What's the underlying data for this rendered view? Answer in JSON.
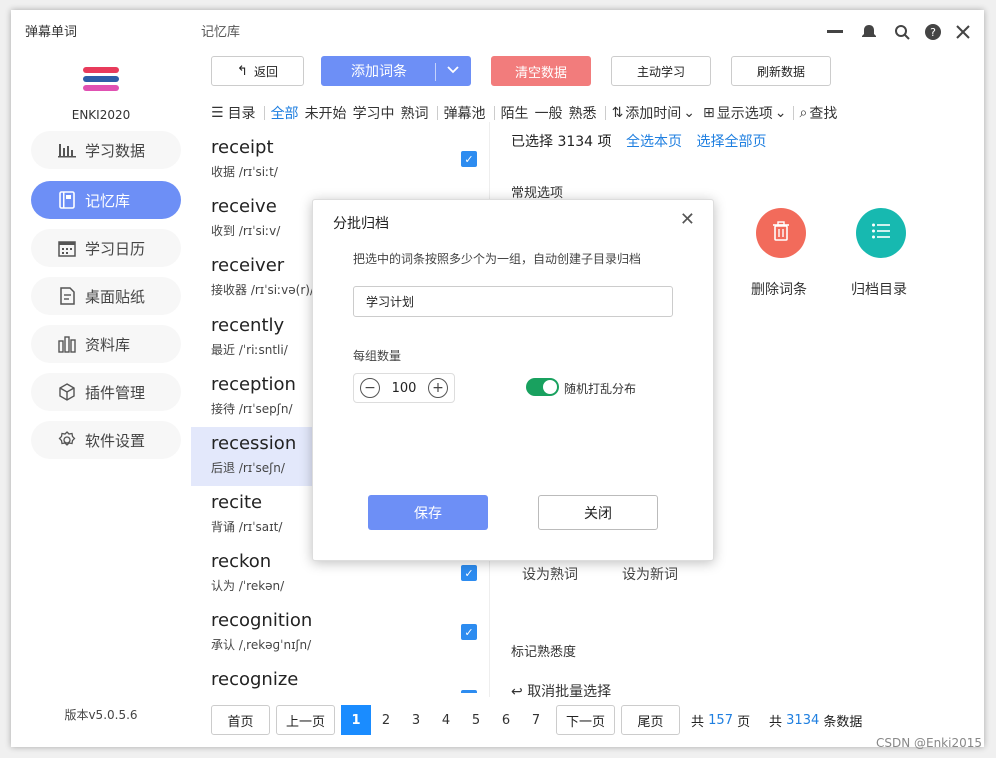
{
  "app": {
    "name": "弹幕单词",
    "window_title": "记忆库",
    "username": "ENKI2020",
    "version": "版本v5.0.5.6"
  },
  "sidebar": {
    "items": [
      {
        "label": "学习数据",
        "icon": "bar-chart-icon"
      },
      {
        "label": "记忆库",
        "icon": "book-icon"
      },
      {
        "label": "学习日历",
        "icon": "calendar-icon"
      },
      {
        "label": "桌面贴纸",
        "icon": "sticker-icon"
      },
      {
        "label": "资料库",
        "icon": "library-icon"
      },
      {
        "label": "插件管理",
        "icon": "cube-icon"
      },
      {
        "label": "软件设置",
        "icon": "gear-icon"
      }
    ]
  },
  "toolbar": {
    "back": "返回",
    "add_words": "添加词条",
    "clear_data": "清空数据",
    "active_learn": "主动学习",
    "refresh": "刷新数据"
  },
  "filters": {
    "catalog": "目录",
    "all": "全部",
    "not_started": "未开始",
    "learning": "学习中",
    "familiar": "熟词",
    "danmaku_pool": "弹幕池",
    "strange": "陌生",
    "normal": "一般",
    "known": "熟悉",
    "add_time": "添加时间",
    "display_options": "显示选项",
    "search": "查找"
  },
  "words": [
    {
      "word": "receipt",
      "meaning": "收据  /rɪˈsiːt/",
      "checked": true
    },
    {
      "word": "receive",
      "meaning": "收到  /rɪˈsiːv/",
      "checked": false
    },
    {
      "word": "receiver",
      "meaning": "接收器  /rɪˈsiːvə(r)/",
      "checked": false
    },
    {
      "word": "recently",
      "meaning": "最近  /ˈriːsntli/",
      "checked": false
    },
    {
      "word": "reception",
      "meaning": "接待  /rɪˈsepʃn/",
      "checked": false
    },
    {
      "word": "recession",
      "meaning": "后退  /rɪˈseʃn/",
      "checked": false
    },
    {
      "word": "recite",
      "meaning": "背诵  /rɪˈsaɪt/",
      "checked": false
    },
    {
      "word": "reckon",
      "meaning": "认为  /ˈrekən/",
      "checked": true
    },
    {
      "word": "recognition",
      "meaning": "承认  /ˌrekəɡˈnɪʃn/",
      "checked": true
    },
    {
      "word": "recognize",
      "meaning": "",
      "checked": true
    }
  ],
  "right_panel": {
    "selected_prefix": "已选择",
    "selected_count": "3134",
    "selected_suffix": "项",
    "select_page": "全选本页",
    "select_all": "选择全部页",
    "general_options": "常规选项",
    "delete_words": "删除词条",
    "archive_catalog": "归档目录",
    "set_familiar": "设为熟词",
    "set_new": "设为新词",
    "mark_familiarity": "标记熟悉度",
    "cancel_batch": "取消批量选择"
  },
  "pagination": {
    "first": "首页",
    "prev": "上一页",
    "pages": [
      "1",
      "2",
      "3",
      "4",
      "5",
      "6",
      "7"
    ],
    "current": "1",
    "next": "下一页",
    "last": "尾页",
    "total_prefix": "共",
    "total_pages": "157",
    "pages_unit": "页",
    "total_prefix2": "共",
    "total_records": "3134",
    "records_unit": "条数据"
  },
  "dialog": {
    "title": "分批归档",
    "hint": "把选中的词条按照多少个为一组，自动创建子目录归档",
    "name_value": "学习计划",
    "group_size_label": "每组数量",
    "group_size": "100",
    "shuffle_label": "随机打乱分布",
    "shuffle_on": true,
    "save": "保存",
    "close": "关闭"
  },
  "watermark": "CSDN @Enki2015",
  "colors": {
    "accent": "#6d8ff6",
    "danger": "#f27c7c",
    "link": "#1f7fe0",
    "delete_circle": "#f26b5b",
    "archive_circle": "#17b9b0",
    "toggle": "#19a15f"
  }
}
